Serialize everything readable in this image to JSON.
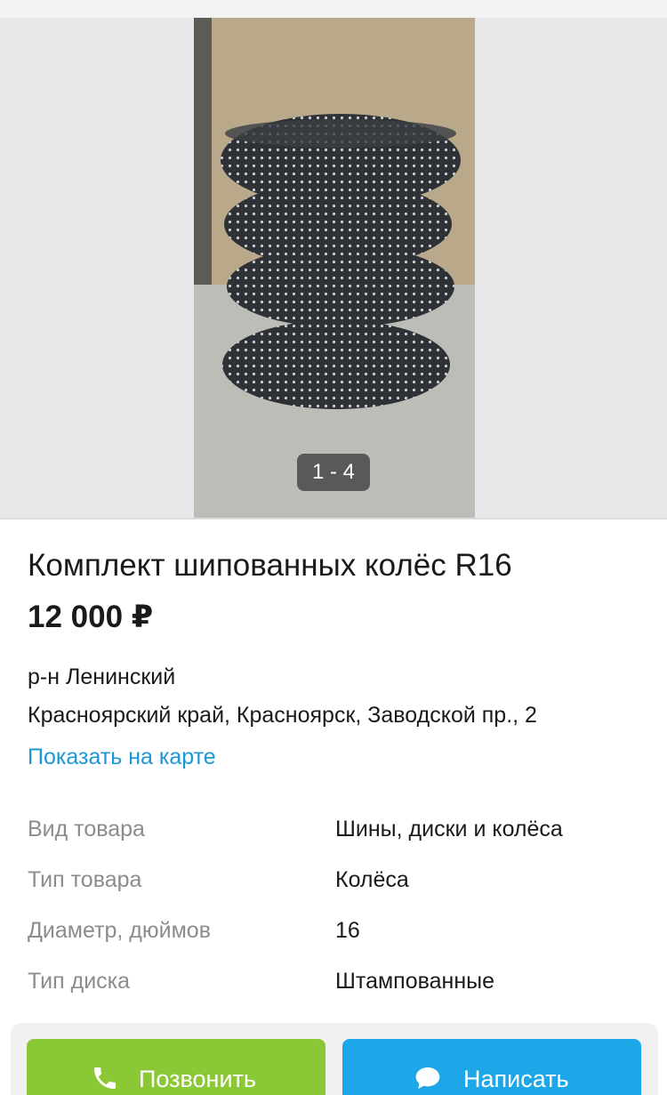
{
  "gallery": {
    "counter": "1 - 4"
  },
  "listing": {
    "title": "Комплект шипованных колёс R16",
    "price": "12 000 ₽",
    "district": "р-н Ленинский",
    "address": "Красноярский край, Красноярск, Заводской пр., 2",
    "map_link": "Показать на карте"
  },
  "params": [
    {
      "key": "Вид товара",
      "value": "Шины, диски и колёса"
    },
    {
      "key": "Тип товара",
      "value": "Колёса"
    },
    {
      "key": "Диаметр, дюймов",
      "value": "16"
    },
    {
      "key": "Тип диска",
      "value": "Штампованные"
    }
  ],
  "actions": {
    "call_label": "Позвонить",
    "call_icon": "phone-icon",
    "write_label": "Написать",
    "write_icon": "chat-bubble-icon",
    "call_color": "#8bc835",
    "write_color": "#1da7e8"
  },
  "colors": {
    "link": "#1a97d6",
    "param_key": "#8c8c8c"
  }
}
